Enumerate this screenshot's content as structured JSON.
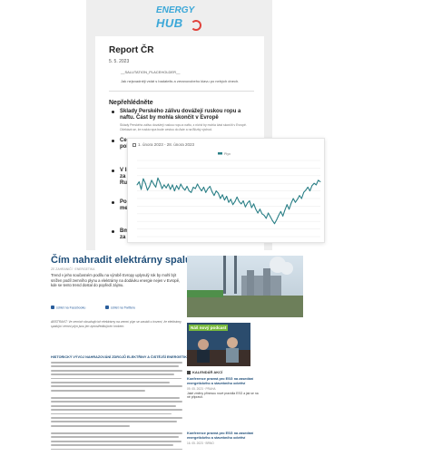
{
  "newsletter": {
    "logo_top": "ENERGY",
    "logo_bottom": "HUB",
    "title": "Report ČR",
    "date": "5. 5. 2023",
    "placeholder": "__SALUTATION_PLACEHOLDER__",
    "intro": "Jak nejsnadněji vstát s badatelis a zeranovobeho klavu po nebých dnech.",
    "section": "Nepřehlédněte",
    "items": [
      {
        "title": "Sklady Perského zálivu dovážejí ruskou ropu a naftu. Část by mohla skončit v Evropě",
        "desc": "Sklady Perského zálivu dovážejí ruskou ropu a naftu, z nichž by mohla část skončit v Evropě. Očekává se, že ruská ropa bude cestou do Asie a na Blízký východ."
      },
      {
        "title": "Cen\npolice",
        "desc": ""
      },
      {
        "title": "V litr\nza S\nRusk",
        "desc": ""
      },
      {
        "title": "Pol\nmezi",
        "desc": ""
      },
      {
        "title": "Bmo\nza e",
        "desc": ""
      }
    ]
  },
  "chart_card": {
    "date_range": "1. února 2023 - 28. února 2023",
    "legend": "Plyn"
  },
  "chart_data": {
    "type": "line",
    "title": "",
    "xlabel": "",
    "ylabel": "",
    "ylim": [
      0,
      10
    ],
    "grid": true,
    "legend_position": "top-center",
    "color": "#2a7f86",
    "series": [
      {
        "name": "Plyn",
        "values": [
          6.8,
          7.2,
          6.2,
          7.6,
          7.0,
          6.1,
          6.6,
          7.4,
          6.9,
          6.5,
          7.7,
          7.1,
          6.3,
          6.8,
          6.4,
          6.9,
          6.2,
          6.8,
          6.0,
          6.7,
          6.2,
          6.9,
          6.4,
          6.1,
          6.6,
          6.0,
          5.8,
          6.5,
          6.3,
          6.9,
          6.4,
          6.0,
          6.5,
          5.8,
          6.3,
          6.6,
          5.9,
          5.4,
          6.0,
          5.7,
          5.0,
          5.5,
          4.8,
          5.3,
          4.5,
          4.9,
          4.2,
          4.6,
          5.2,
          4.6,
          4.3,
          4.7,
          3.9,
          4.4,
          4.7,
          3.8,
          4.3,
          3.6,
          3.1,
          3.6,
          3.0,
          2.8,
          2.4,
          3.1,
          2.6,
          2.1,
          1.7,
          2.2,
          2.8,
          3.3,
          2.7,
          3.5,
          4.2,
          3.6,
          4.4,
          5.0,
          4.5,
          4.9,
          5.4,
          5.0,
          5.8,
          6.1,
          6.5,
          6.0,
          6.7,
          7.0,
          6.8,
          7.4,
          7.2
        ]
      }
    ]
  },
  "article": {
    "title": "Čím nahradit elektrárny spalující zemní plyn?",
    "meta": "ZE ZAHRANIČÍ · ENERGETIKA",
    "lead": "Trend v jeho současném podílu na výrobě Evropy uplynulý rok by mohl být snížen podíl zemního plynu a elektrárny na dodávku energie nejen v Evropě, kde se tento trend dostal do popředí zájmu.",
    "social_1": "sdílet na Facebooku",
    "social_2": "sdílet na Twitteru",
    "caption": "ABSTRAKT: Ve zemích obsahujících elektrárny na zemní plyn se zavádí s tvrzení, že elektrárny spalující zemní plyn jsou jen zprostředkujícím krokem.",
    "subheading": "HISTORICKÝ VÝVOJ NAHRAZOVÁNÍ ZDROJŮ ELEKTŘINY A ČISTĚJŠÍ ENERGETIKY",
    "promo_label": "Náš nový podcast",
    "calendar_head": "KALENDÁŘ AKCÍ",
    "calendar": [
      {
        "title": "Konference pravná pro ESG na zasedání energetického a stavebního odvětví",
        "date": "09. 05. 2023 · PRAHA",
        "desc": "Jaké změny přinesou nové pravidla ESG a jak se na ně připravit."
      },
      {
        "title": "Konference pravná pro ESG na zasedání energetického a stavebního odvětví",
        "date": "16. 05. 2023 · BRNO",
        "desc": ""
      }
    ]
  }
}
